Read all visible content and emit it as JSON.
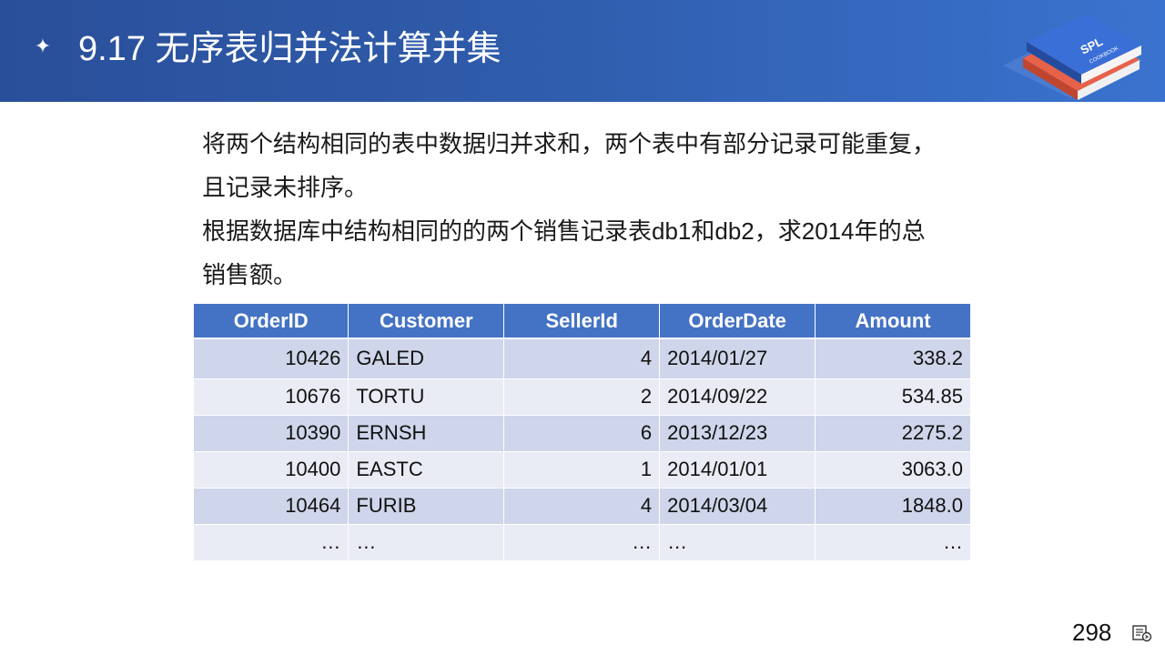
{
  "header": {
    "title": "9.17 无序表归并法计算并集",
    "bullet_icon": "sparkle-icon",
    "logo_text": "SPL",
    "logo_subtext": "COOKBOOK"
  },
  "body": {
    "lines": [
      "将两个结构相同的表中数据归并求和，两个表中有部分记录可能重复，",
      "且记录未排序。",
      "根据数据库中结构相同的的两个销售记录表db1和db2，求2014年的总",
      "销售额。"
    ]
  },
  "table": {
    "headers": [
      "OrderID",
      "Customer",
      "SellerId",
      "OrderDate",
      "Amount"
    ],
    "rows": [
      [
        "10426",
        "GALED",
        "4",
        "2014/01/27",
        "338.2"
      ],
      [
        "10676",
        "TORTU",
        "2",
        "2014/09/22",
        "534.85"
      ],
      [
        "10390",
        "ERNSH",
        "6",
        "2013/12/23",
        "2275.2"
      ],
      [
        "10400",
        "EASTC",
        "1",
        "2014/01/01",
        "3063.0"
      ],
      [
        "10464",
        "FURIB",
        "4",
        "2014/03/04",
        "1848.0"
      ],
      [
        "…",
        "…",
        "…",
        "…",
        "…"
      ]
    ]
  },
  "footer": {
    "page_number": "298",
    "nav_icon": "slide-nav-icon"
  },
  "colors": {
    "header_start": "#2a4f9a",
    "header_end": "#3a73cf",
    "table_header": "#4472c4",
    "row_odd": "#cfd5ea",
    "row_even": "#e9ebf5"
  }
}
